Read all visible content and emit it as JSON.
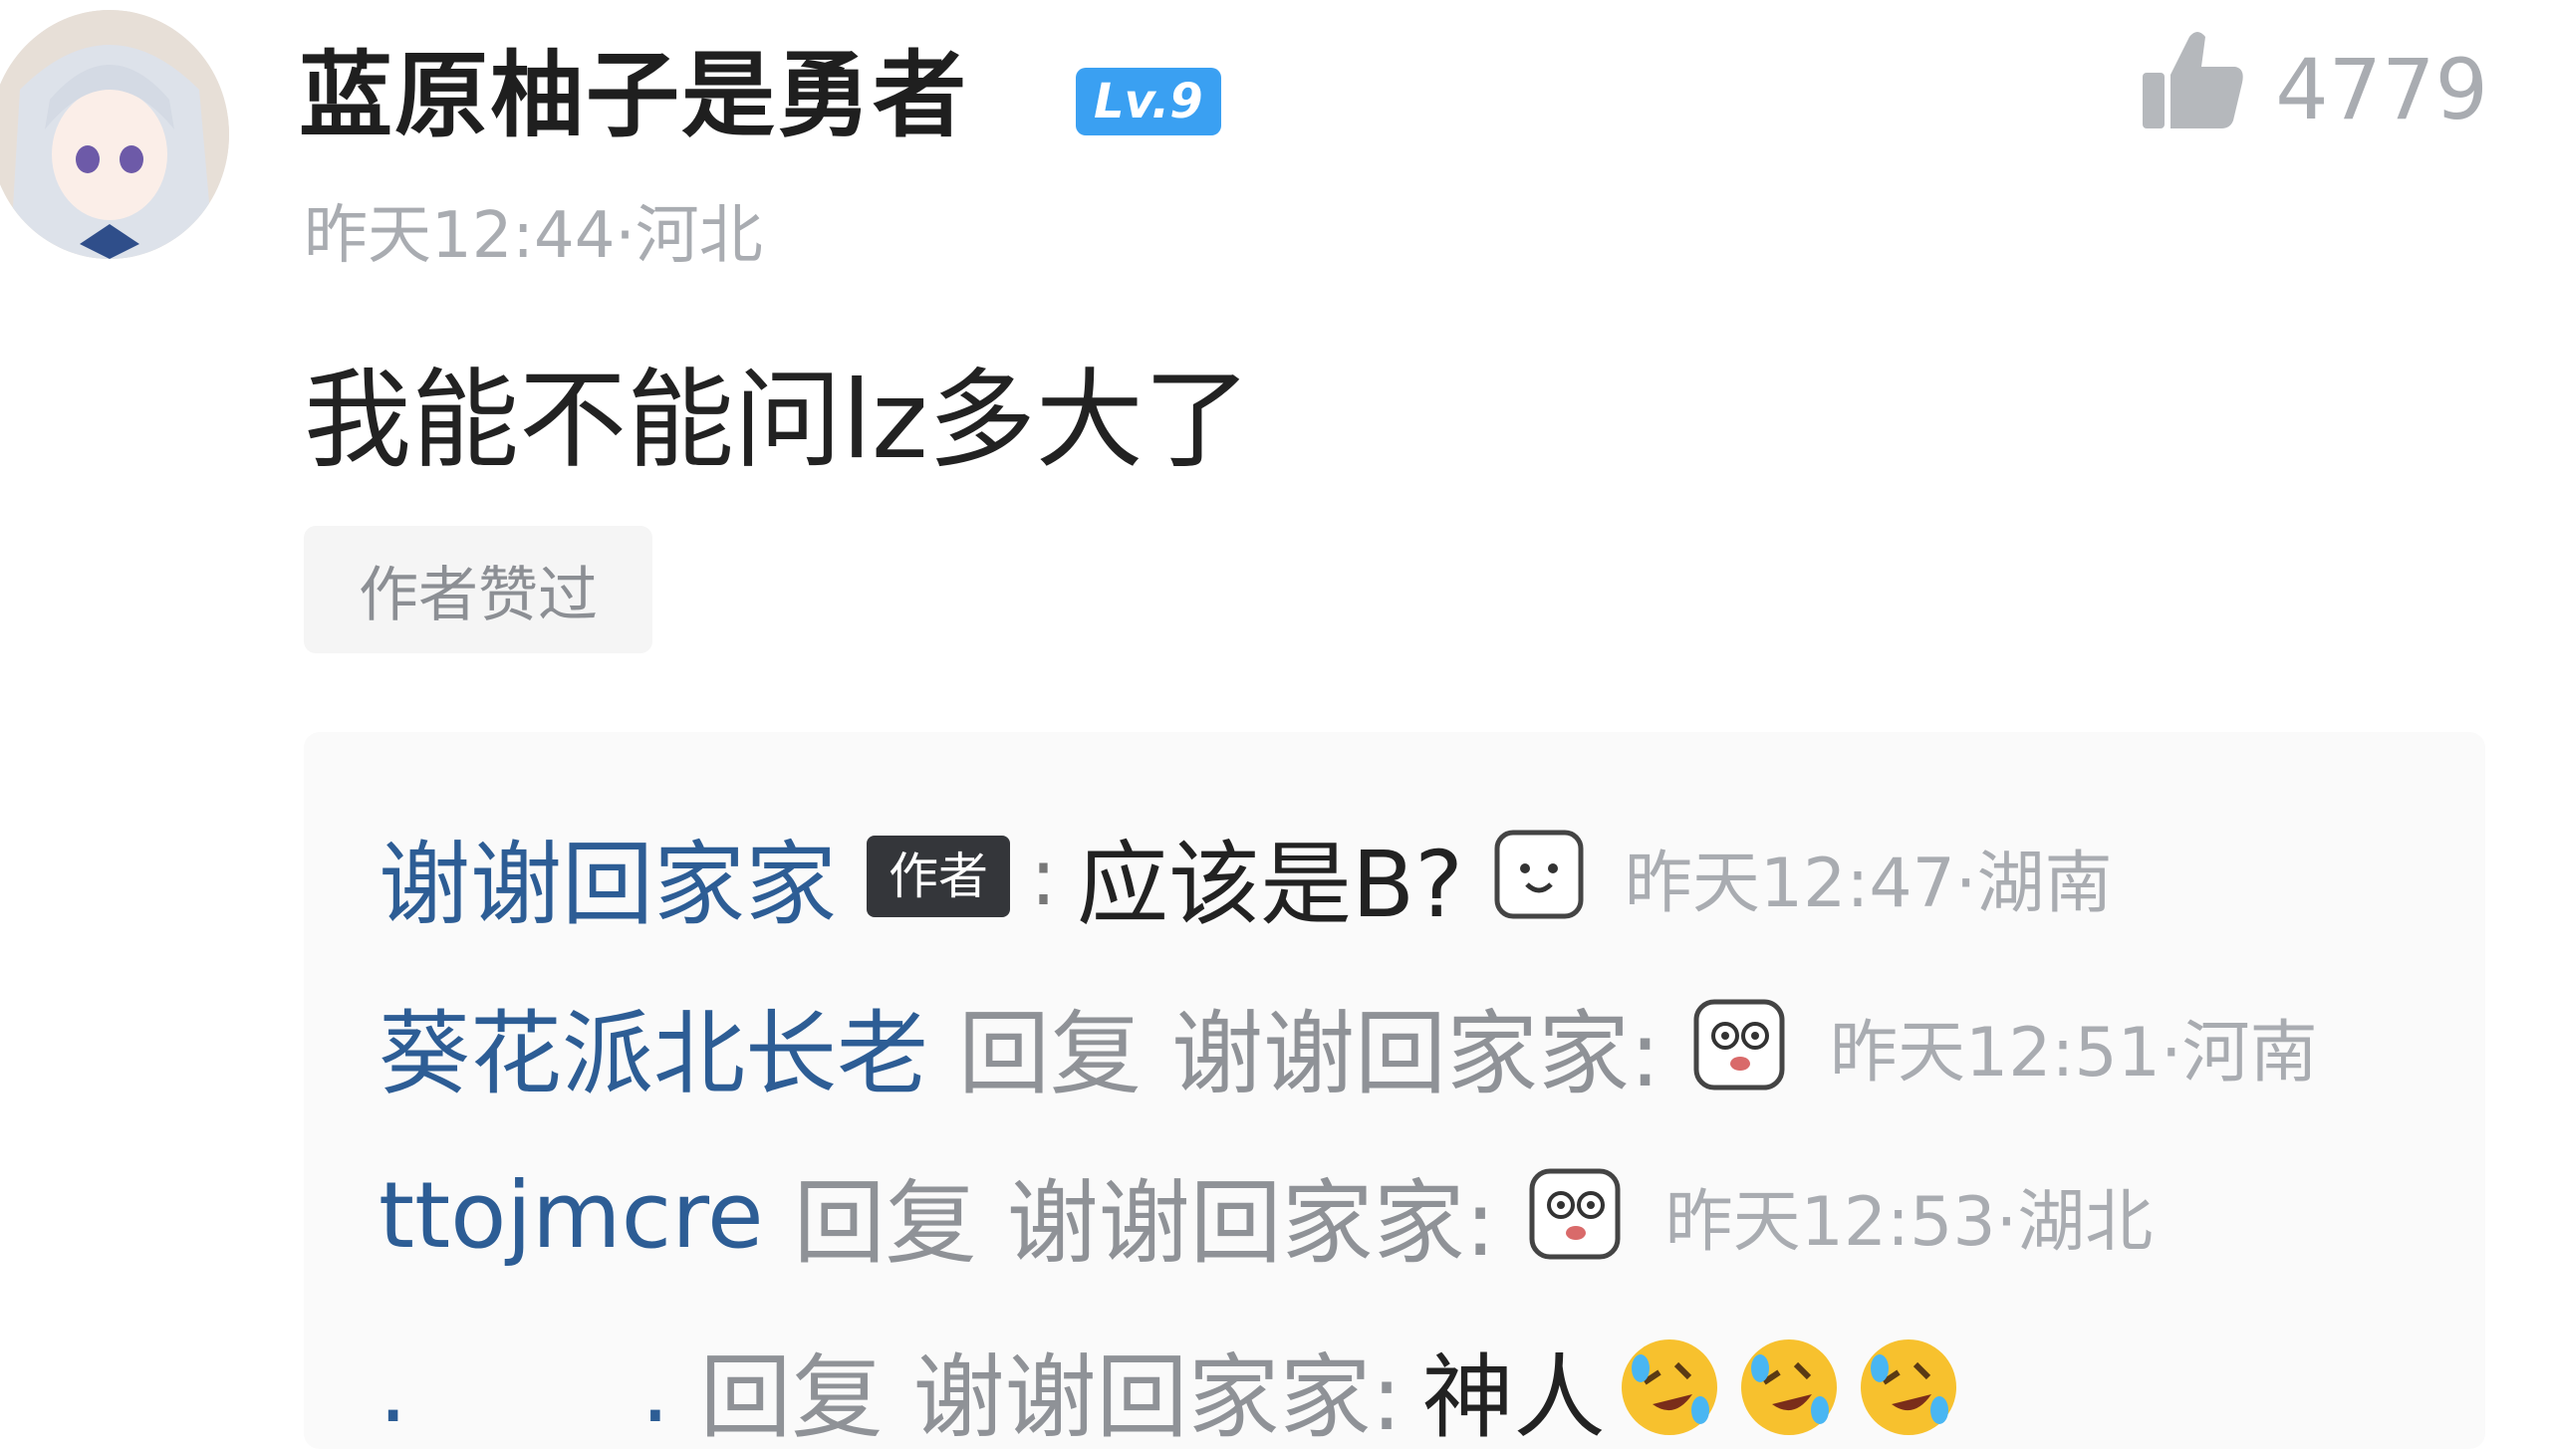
{
  "comment": {
    "username": "蓝原柚子是勇者",
    "level": "Lv.9",
    "likes": "4779",
    "meta": "昨天12:44·河北",
    "text": "我能不能问lz多大了",
    "author_liked": "作者赞过"
  },
  "replies": [
    {
      "name": "谢谢回家家",
      "tag": "作者",
      "text": "应该是B?",
      "emoji": "smile-face-icon",
      "time": "昨天12:47·湖南"
    },
    {
      "name": "葵花派北长老",
      "reply_word": "回复",
      "target": "谢谢回家家:",
      "emoji": "surprised-face-icon",
      "time": "昨天12:51·河南"
    },
    {
      "name": "ttojmcre",
      "reply_word": "回复",
      "target": "谢谢回家家:",
      "emoji": "surprised-face-icon",
      "time": "昨天12:53·湖北"
    },
    {
      "name": ".        .",
      "reply_word": "回复",
      "target": "谢谢回家家:",
      "text": "神人",
      "emoji": "rolling-laughing-icon"
    }
  ],
  "colors": {
    "name_blue": "#2d5d95",
    "badge_blue": "#3aa0f2",
    "gray": "#a9acb1"
  }
}
